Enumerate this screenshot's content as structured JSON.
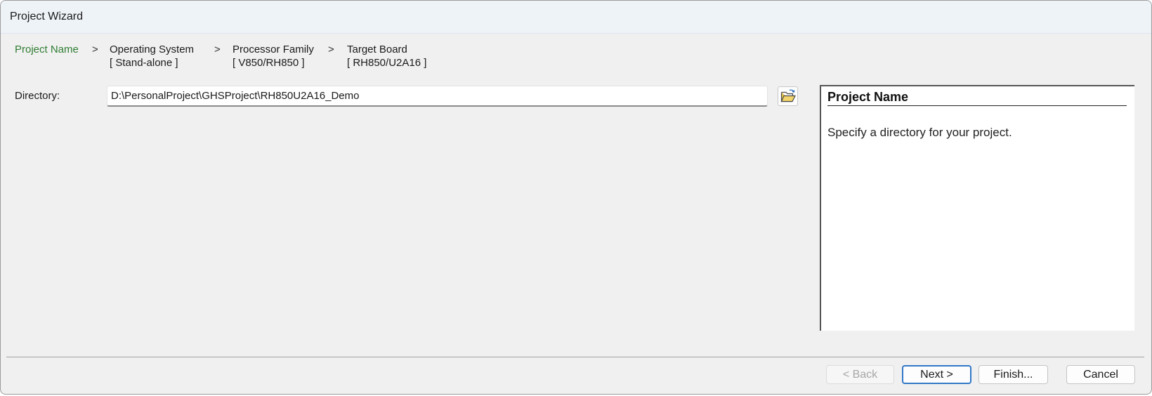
{
  "window": {
    "title": "Project Wizard"
  },
  "breadcrumb": {
    "separator": ">",
    "steps": [
      {
        "label": "Project Name",
        "value": ""
      },
      {
        "label": "Operating System",
        "value": "[ Stand-alone ]"
      },
      {
        "label": "Processor Family",
        "value": "[ V850/RH850 ]"
      },
      {
        "label": "Target Board",
        "value": "[ RH850/U2A16 ]"
      }
    ],
    "active_color": "#2f7d32"
  },
  "directory": {
    "label": "Directory:",
    "value": "D:\\PersonalProject\\GHSProject\\RH850U2A16_Demo",
    "browse_icon": "folder-open-icon"
  },
  "help": {
    "title": "Project Name",
    "text": "Specify a directory for your project."
  },
  "buttons": {
    "back": "< Back",
    "next": "Next >",
    "finish": "Finish...",
    "cancel": "Cancel"
  },
  "colors": {
    "accent": "#3278c8",
    "folder": "#e8c34a"
  }
}
